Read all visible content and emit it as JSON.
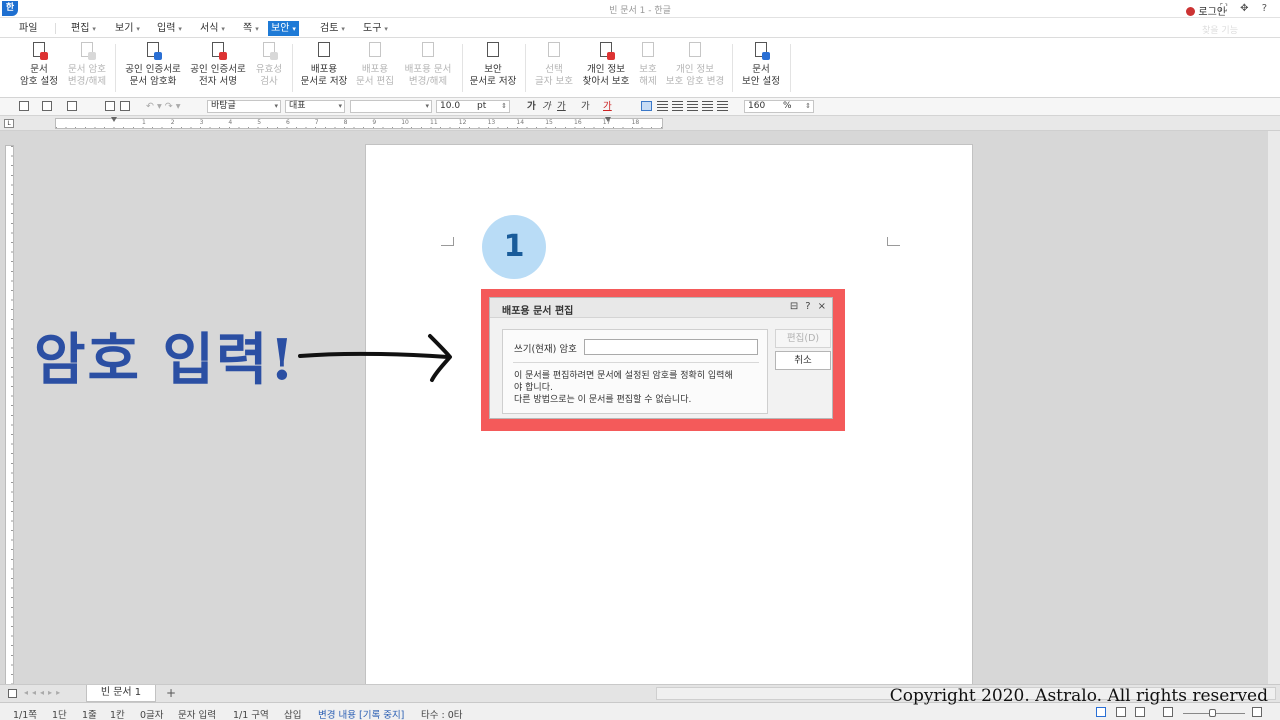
{
  "titlebar": {
    "logo": "한",
    "title": "빈 문서 1 - 한글",
    "login": "로그인",
    "controls": "⛶ ✥ ?"
  },
  "menu": {
    "items": [
      {
        "label": "파일",
        "arrow": ""
      },
      {
        "label": "편집",
        "arrow": "▾"
      },
      {
        "label": "보기",
        "arrow": "▾"
      },
      {
        "label": "입력",
        "arrow": "▾"
      },
      {
        "label": "서식",
        "arrow": "▾"
      },
      {
        "label": "쪽",
        "arrow": "▾"
      },
      {
        "label": "보안",
        "arrow": "▾",
        "active": true
      },
      {
        "label": "검토",
        "arrow": "▾"
      },
      {
        "label": "도구",
        "arrow": "▾"
      }
    ],
    "right_faint": "찾을 기능"
  },
  "ribbon": {
    "buttons": [
      {
        "line1": "문서",
        "line2": "암호 설정",
        "enabled": true
      },
      {
        "line1": "문서 암호",
        "line2": "변경/해제",
        "enabled": false
      },
      {
        "line1": "공인 인증서로",
        "line2": "문서 암호화",
        "enabled": true
      },
      {
        "line1": "공인 인증서로",
        "line2": "전자 서명",
        "enabled": true
      },
      {
        "line1": "유효성",
        "line2": "검사",
        "enabled": false
      },
      {
        "line1": "배포용",
        "line2": "문서로 저장",
        "enabled": true
      },
      {
        "line1": "배포용",
        "line2": "문서 편집",
        "enabled": false
      },
      {
        "line1": "배포용 문서",
        "line2": "변경/해제",
        "enabled": false
      },
      {
        "line1": "보안",
        "line2": "문서로 저장",
        "enabled": true
      },
      {
        "line1": "선택",
        "line2": "글자 보호",
        "enabled": false
      },
      {
        "line1": "개인 정보",
        "line2": "찾아서 보호",
        "enabled": true
      },
      {
        "line1": "보호",
        "line2": "해제",
        "enabled": false
      },
      {
        "line1": "개인 정보",
        "line2": "보호 암호 변경",
        "enabled": false
      },
      {
        "line1": "문서",
        "line2": "보안 설정",
        "enabled": true
      }
    ]
  },
  "format": {
    "style": "바탕글",
    "lang": "대표",
    "font": "",
    "size": "10.0",
    "unit": "pt",
    "char_btns": [
      "가",
      "가",
      "가",
      "가",
      "가"
    ],
    "zoom": "160",
    "zoom_unit": "%"
  },
  "ruler": {
    "numbers": [
      "1",
      "2",
      "3",
      "4",
      "5",
      "6",
      "7",
      "8",
      "9",
      "10",
      "11",
      "12",
      "13",
      "14",
      "15",
      "16",
      "17",
      "18"
    ]
  },
  "step": {
    "number": "1"
  },
  "annotation": {
    "text": "암호 입력!"
  },
  "dialog": {
    "title": "배포용 문서 편집",
    "icons": [
      "⊟",
      "?",
      "×"
    ],
    "password_label": "쓰기(현재) 암호",
    "password_value": "",
    "message_line1": "이 문서를 편집하려면 문서에 설정된 암호를 정확히 입력해",
    "message_line2": "야 합니다.",
    "message_line3": "다른 방법으로는 이 문서를 편집할 수 없습니다.",
    "edit_button": "편집(D)",
    "cancel_button": "취소"
  },
  "tabs": {
    "nav": "◂◂◂▸▸",
    "doc_tab": "빈 문서 1",
    "add": "+"
  },
  "status": {
    "page": "1/1쪽",
    "column": "1단",
    "line": "1줄",
    "col_pos": "1칸",
    "chars": "0글자",
    "mode": "문자 입력",
    "section": "1/1 구역",
    "insert": "삽입",
    "track": "변경 내용 [기록 중지]",
    "typing": "타수 : 0타"
  },
  "copyright": "Copyright 2020. Astralo. All rights reserved",
  "colors": {
    "accent": "#1e7ad6",
    "highlight_frame": "#f45a5a",
    "annotation": "#2b4fa3",
    "bubble": "#b9dcf6"
  }
}
